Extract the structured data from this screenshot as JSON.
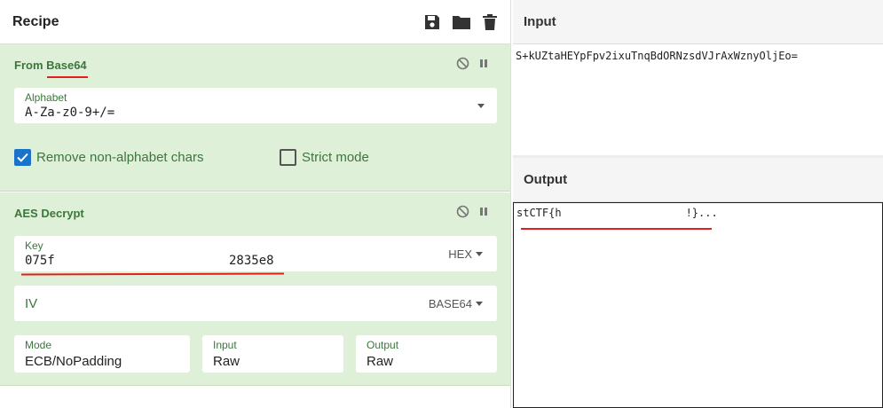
{
  "recipe": {
    "title": "Recipe",
    "icons": [
      "save-icon",
      "folder-icon",
      "trash-icon"
    ],
    "from_base64": {
      "title_prefix": "From ",
      "title_name": "Base64",
      "alphabet_label": "Alphabet",
      "alphabet_value": "A-Za-z0-9+/=",
      "remove_non_alpha_label": "Remove non-alphabet chars",
      "remove_non_alpha_checked": true,
      "strict_mode_label": "Strict mode",
      "strict_mode_checked": false
    },
    "aes_decrypt": {
      "title": "AES Decrypt",
      "key_label": "Key",
      "key_value_start": "075f",
      "key_value_end": "2835e8",
      "key_encoding": "HEX",
      "iv_label": "IV",
      "iv_encoding": "BASE64",
      "mode_label": "Mode",
      "mode_value": "ECB/NoPadding",
      "input_label": "Input",
      "input_value": "Raw",
      "output_label": "Output",
      "output_value": "Raw"
    }
  },
  "input": {
    "title": "Input",
    "text": "S+kUZtaHEYpFpv2ixuTnqBdORNzsdVJrAxWznyOljEo="
  },
  "output": {
    "title": "Output",
    "text_start": "stCTF{h",
    "text_end": "!}..."
  },
  "colors": {
    "op_bg": "#dff0d8",
    "op_text": "#3c763d",
    "checkbox_on": "#1a73c9",
    "annotation_red": "#e02020"
  }
}
